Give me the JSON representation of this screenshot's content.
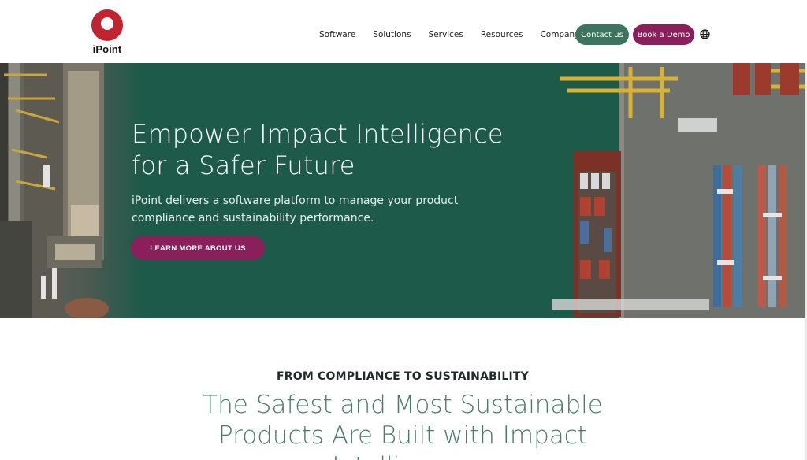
{
  "header": {
    "logo_text": "iPoint",
    "nav": [
      "Software",
      "Solutions",
      "Services",
      "Resources",
      "Company"
    ],
    "contact_label": "Contact us",
    "demo_label": "Book a Demo",
    "globe_icon": "globe-icon"
  },
  "hero": {
    "title_line1": "Empower Impact Intelligence",
    "title_line2": "for a Safer Future",
    "subtitle_line1": "iPoint delivers a software platform to manage your product",
    "subtitle_line2": "compliance and sustainability performance.",
    "cta_label": "LEARN MORE ABOUT US",
    "background_color": "#1e5a4a"
  },
  "section": {
    "eyebrow": "FROM COMPLIANCE TO SUSTAINABILITY",
    "title_line1": "The Safest and Most Sustainable",
    "title_line2": "Products Are Built with Impact",
    "title_line3": "Intelligence"
  },
  "colors": {
    "brand_red": "#c0242e",
    "green": "#3c7460",
    "magenta": "#8a1f5b",
    "heading_green": "#4a7c6c"
  }
}
